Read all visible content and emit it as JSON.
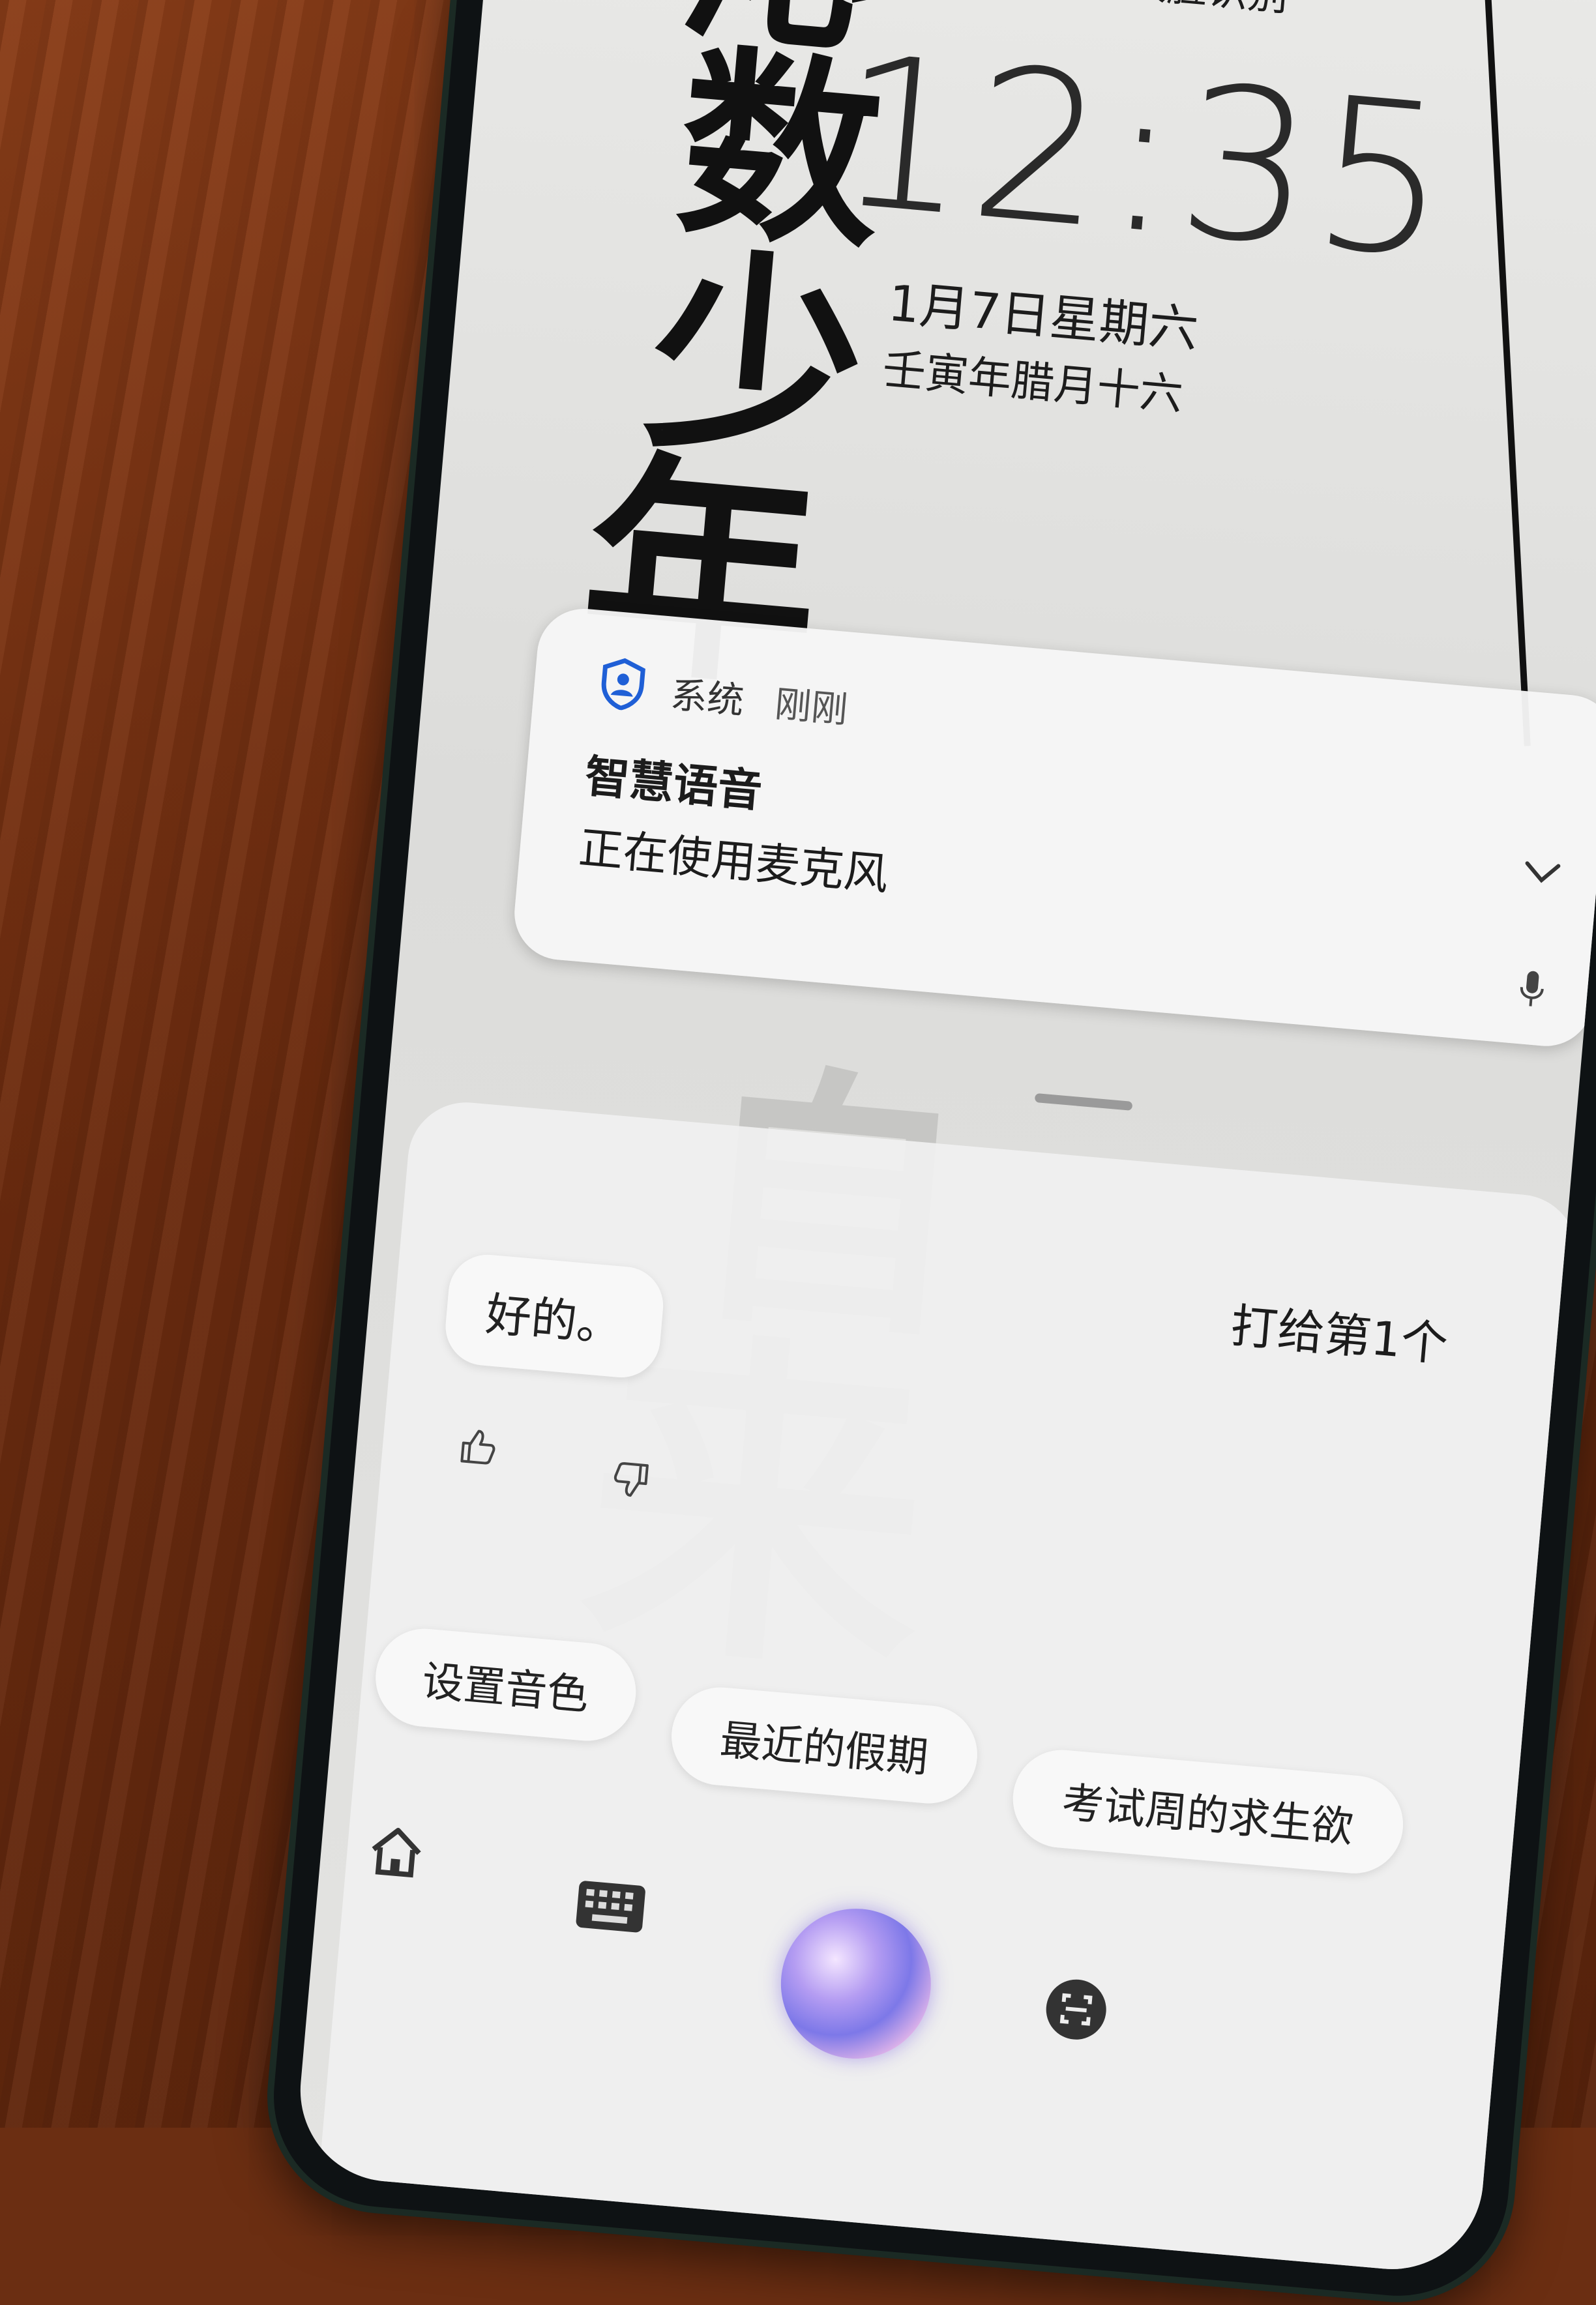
{
  "lockscreen": {
    "face_unlock_hint": "双击屏幕进行人脸识别",
    "time": "12:35",
    "date": "1月7日星期六",
    "lunar_date": "壬寅年腊月十六"
  },
  "notification": {
    "app": "系统",
    "time": "刚刚",
    "title": "智慧语音",
    "message": "正在使用麦克风"
  },
  "assistant": {
    "user_query": "打给第1个",
    "reply": "好的。",
    "suggestions": [
      "设置音色",
      "最近的假期",
      "考试周的求生欲"
    ]
  },
  "icons": [
    "shield-person-icon",
    "chevron-down-icon",
    "microphone-icon",
    "thumbs-up-icon",
    "thumbs-down-icon",
    "home-icon",
    "keyboard-icon",
    "voice-orb-icon",
    "scan-icon"
  ],
  "colors": {
    "accent_blue": "#1f5fd6",
    "text": "#1c1c1c"
  }
}
